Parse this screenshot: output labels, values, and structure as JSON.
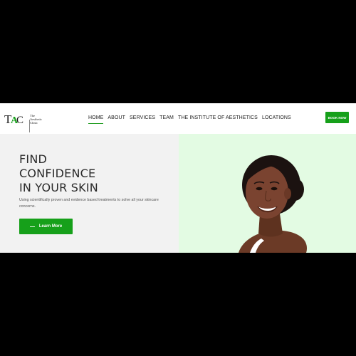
{
  "header": {
    "logo_line1": "The",
    "logo_line2": "Aesthetic",
    "logo_line3": "Clinic",
    "nav": [
      {
        "label": "HOME"
      },
      {
        "label": "ABOUT"
      },
      {
        "label": "SERVICES"
      },
      {
        "label": "TEAM"
      },
      {
        "label": "THE INSTITUTE OF AESTHETICS"
      },
      {
        "label": "LOCATIONS"
      }
    ],
    "book_label": "BOOK NOW"
  },
  "hero": {
    "title_lines": [
      "FIND",
      "CONFIDENCE",
      "IN YOUR SKIN"
    ],
    "subtitle": "Using scientifically proven and evidence based treatments to solve all your skincare concerns.",
    "cta_label": "Learn More"
  },
  "colors": {
    "accent": "#16a01a",
    "hero_left_bg": "#f2f2f2",
    "hero_right_bg": "#e3fbe3",
    "frame_bg": "#000000"
  }
}
